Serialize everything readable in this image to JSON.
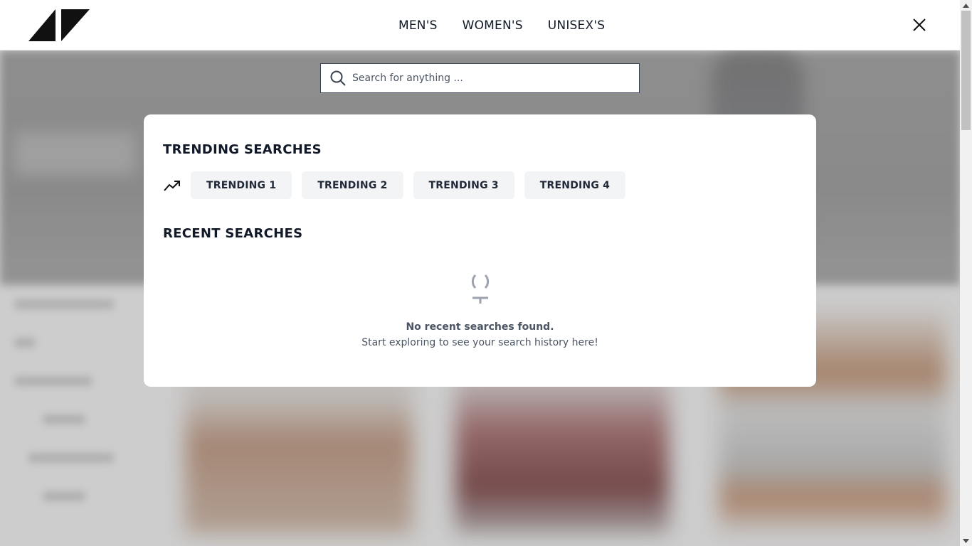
{
  "nav": {
    "items": [
      {
        "label": "MEN'S"
      },
      {
        "label": "WOMEN'S"
      },
      {
        "label": "UNISEX'S"
      }
    ]
  },
  "search": {
    "placeholder": "Search for anything ...",
    "value": ""
  },
  "trending": {
    "title": "TRENDING SEARCHES",
    "items": [
      {
        "label": "TRENDING 1"
      },
      {
        "label": "TRENDING 2"
      },
      {
        "label": "TRENDING 3"
      },
      {
        "label": "TRENDING 4"
      }
    ]
  },
  "recent": {
    "title": "RECENT SEARCHES",
    "empty_title": "No recent searches found.",
    "empty_subtitle": "Start exploring to see your search history here!"
  },
  "icons": {
    "logo": "brand-logo",
    "close": "close-icon",
    "search": "search-icon",
    "trend": "trending-up-icon",
    "empty": "empty-state-icon"
  },
  "colors": {
    "text": "#111827",
    "chip_bg": "#f3f4f6",
    "muted": "#4b5563"
  }
}
